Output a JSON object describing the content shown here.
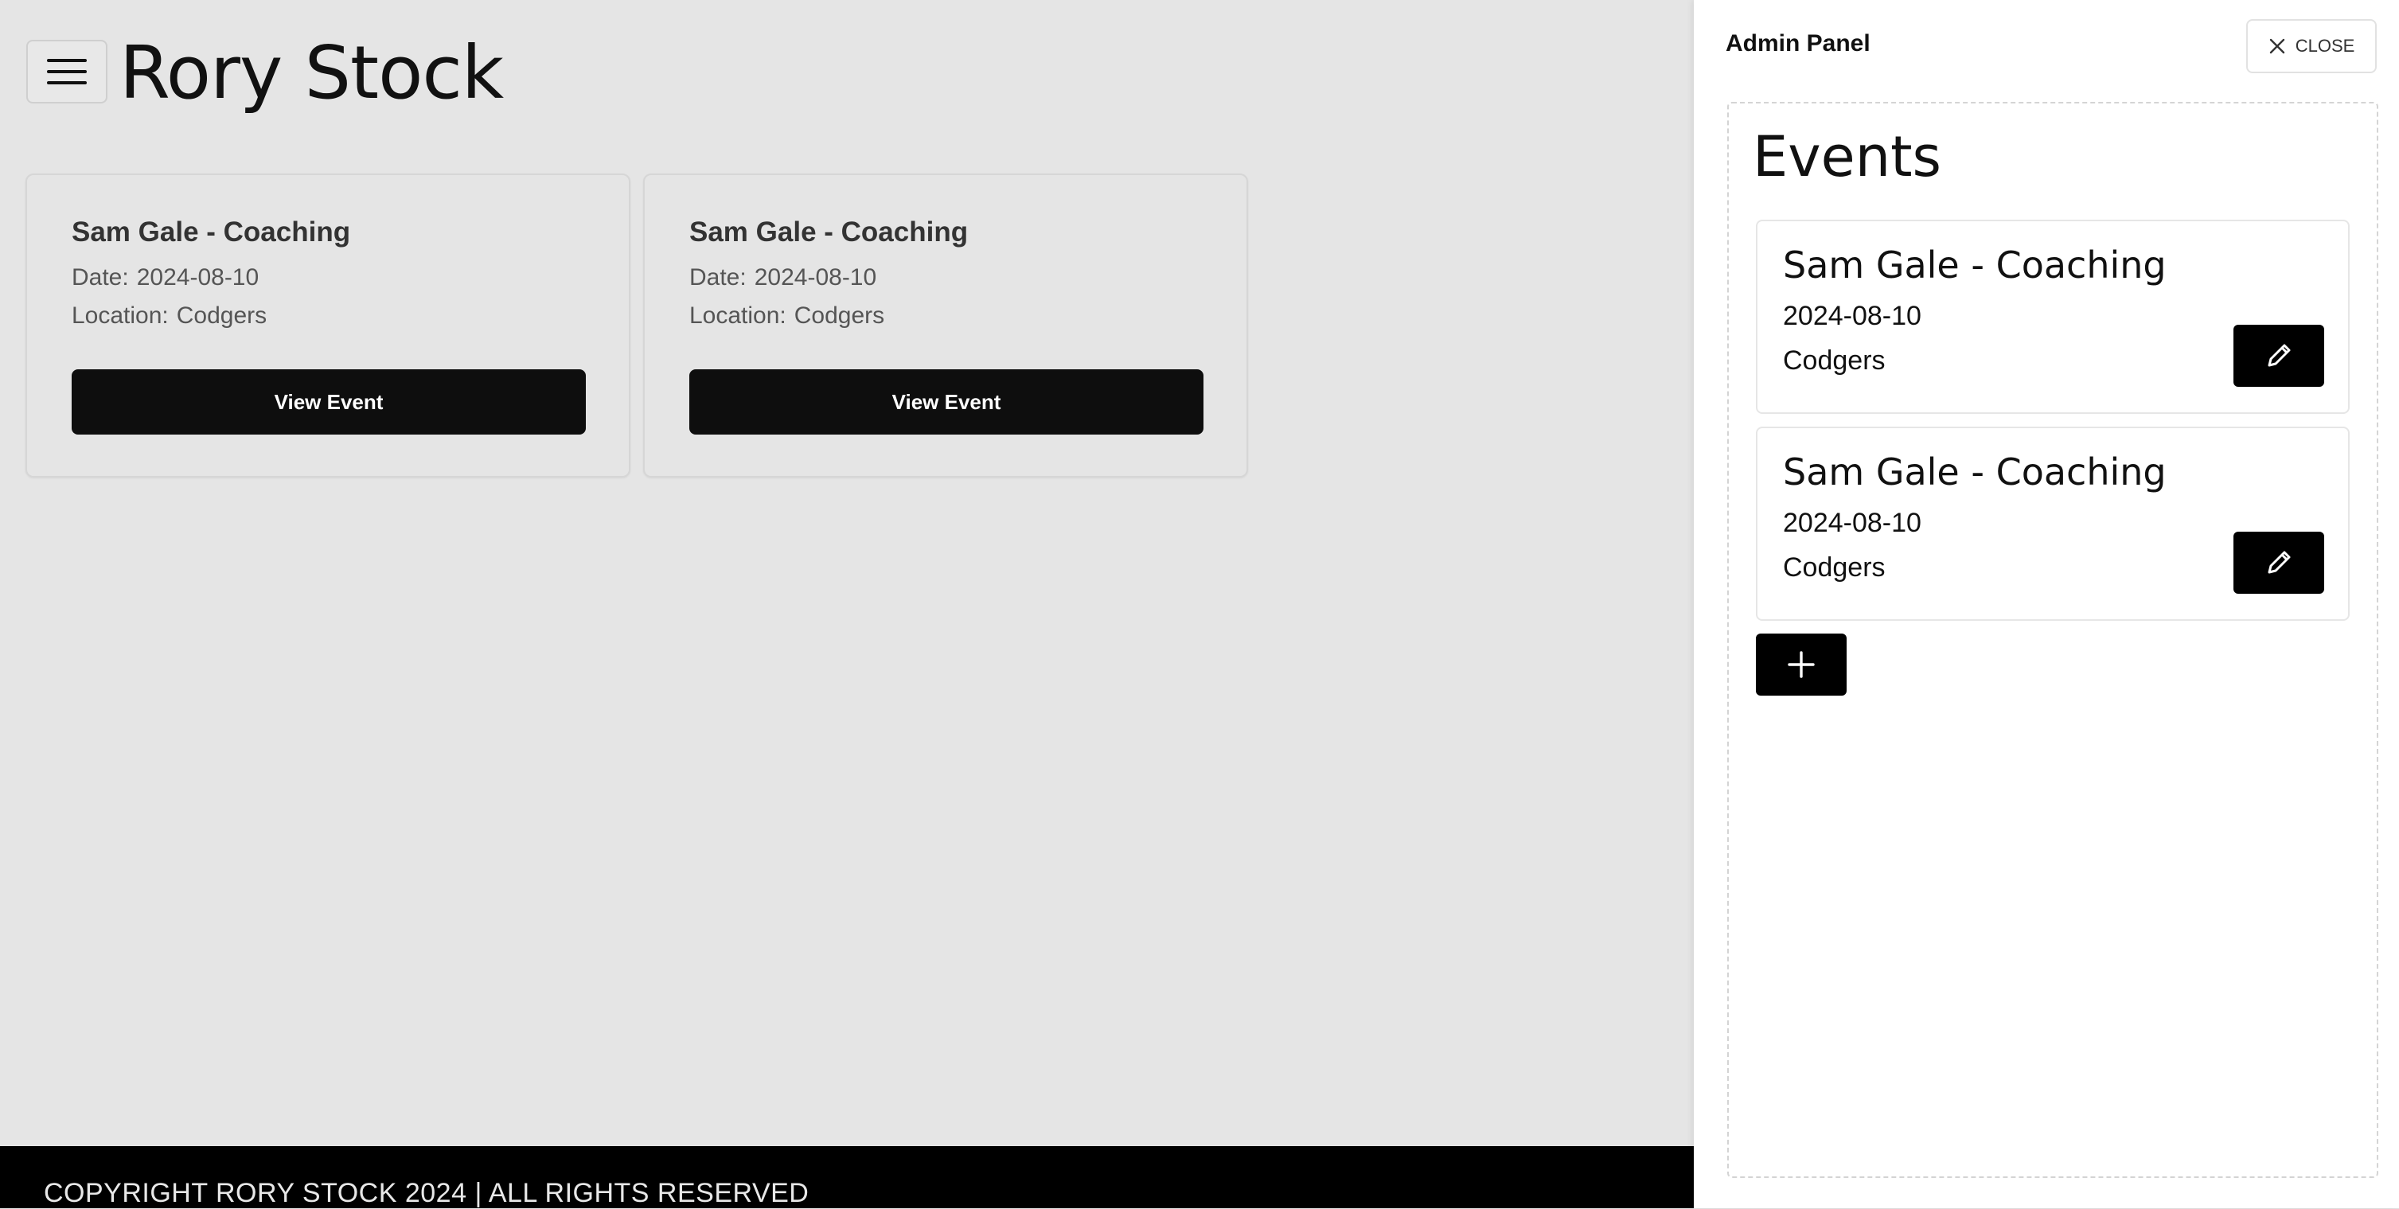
{
  "header": {
    "title": "Rory Stock",
    "menu_icon": "hamburger-menu-icon"
  },
  "events": [
    {
      "title": "Sam Gale - Coaching",
      "date_label": "Date:",
      "date": "2024-08-10",
      "location_label": "Location:",
      "location": "Codgers",
      "button_label": "View Event"
    },
    {
      "title": "Sam Gale - Coaching",
      "date_label": "Date:",
      "date": "2024-08-10",
      "location_label": "Location:",
      "location": "Codgers",
      "button_label": "View Event"
    }
  ],
  "footer": {
    "copyright": "COPYRIGHT RORY STOCK 2024 | ALL RIGHTS RESERVED"
  },
  "admin_panel": {
    "title": "Admin Panel",
    "close_label": "CLOSE",
    "close_icon": "close-x-icon",
    "heading": "Events",
    "items": [
      {
        "title": "Sam Gale - Coaching",
        "date": "2024-08-10",
        "location": "Codgers",
        "edit_icon": "pencil-icon"
      },
      {
        "title": "Sam Gale - Coaching",
        "date": "2024-08-10",
        "location": "Codgers",
        "edit_icon": "pencil-icon"
      }
    ],
    "add_icon": "plus-icon"
  },
  "colors": {
    "page_background": "#e5e5e5",
    "button_background": "#0e0e0e",
    "footer_background": "#000000",
    "panel_background": "#ffffff"
  }
}
